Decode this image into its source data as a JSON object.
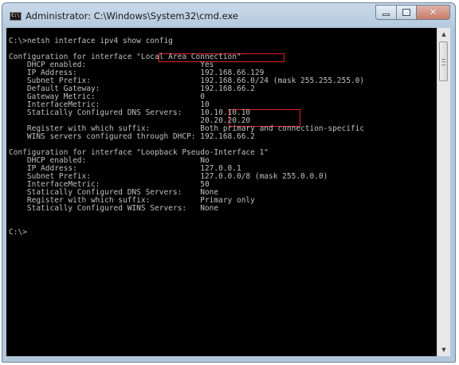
{
  "window": {
    "title": "Administrator: C:\\Windows\\System32\\cmd.exe",
    "icon_label": "C:\\",
    "icon": "console-icon",
    "buttons": {
      "minimize": "minimize-icon",
      "maximize": "maximize-icon",
      "close": "close-icon",
      "close_glyph": "✕"
    }
  },
  "scrollbar": {
    "up_arrow": "▲",
    "down_arrow": "▼"
  },
  "colors": {
    "console_bg": "#000000",
    "console_text": "#c0c0c0",
    "highlight": "#e0202a"
  },
  "console": {
    "lines": [
      "C:\\>netsh interface ipv4 show config",
      "",
      "Configuration for interface \"Local Area Connection\"",
      "    DHCP enabled:                         Yes",
      "    IP Address:                           192.168.66.129",
      "    Subnet Prefix:                        192.168.66.0/24 (mask 255.255.255.0)",
      "    Default Gateway:                      192.168.66.2",
      "    Gateway Metric:                       0",
      "    InterfaceMetric:                      10",
      "    Statically Configured DNS Servers:    10.10.10.10",
      "                                          20.20.20.20",
      "    Register with which suffix:           Both primary and connection-specific",
      "    WINS servers configured through DHCP: 192.168.66.2",
      "",
      "Configuration for interface \"Loopback Pseudo-Interface 1\"",
      "    DHCP enabled:                         No",
      "    IP Address:                           127.0.0.1",
      "    Subnet Prefix:                        127.0.0.0/8 (mask 255.0.0.0)",
      "    InterfaceMetric:                      50",
      "    Statically Configured DNS Servers:    None",
      "    Register with which suffix:           Primary only",
      "    Statically Configured WINS Servers:   None",
      "",
      "",
      "C:\\>"
    ]
  }
}
